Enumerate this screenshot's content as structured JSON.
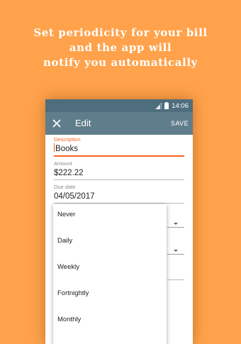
{
  "headline": {
    "line1": "Set periodicity for your bill",
    "line2": "and the app will",
    "line3": "notify you automatically"
  },
  "status_bar": {
    "time": "14:06",
    "icons": [
      "signal-icon",
      "battery-icon"
    ]
  },
  "toolbar": {
    "title": "Edit",
    "save_label": "SAVE",
    "close_icon": "close-icon"
  },
  "form": {
    "description": {
      "label": "Description",
      "value": "Books"
    },
    "amount": {
      "label": "Amount",
      "value": "$222.22"
    },
    "due_date": {
      "label": "Due date",
      "value": "04/05/2017"
    }
  },
  "dropdown": {
    "options": [
      "Never",
      "Daily",
      "Weekly",
      "Fortnightly",
      "Monthly"
    ]
  },
  "colors": {
    "background": "#FFA24B",
    "toolbar": "#607D8B",
    "status_bar": "#4E6E7D",
    "accent": "#F26522"
  }
}
